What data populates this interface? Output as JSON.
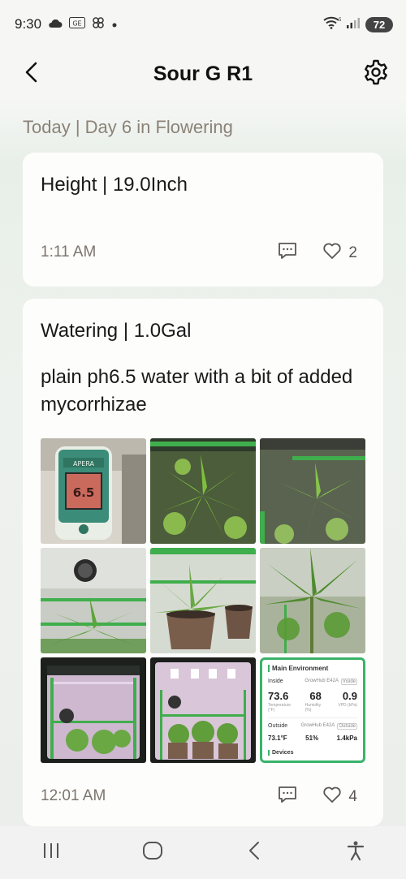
{
  "status_bar": {
    "time": "9:30",
    "battery": "72",
    "icons": [
      "cloud-icon",
      "ge-badge-icon",
      "pinwheel-icon",
      "dot-icon",
      "wifi-icon",
      "signal-icon"
    ]
  },
  "header": {
    "title": "Sour G R1",
    "back_icon": "chevron-left-icon",
    "settings_icon": "gear-icon"
  },
  "day_heading": "Today | Day 6 in Flowering",
  "entries": [
    {
      "title": "Height | 19.0Inch",
      "time": "1:11 AM",
      "likes": "2"
    },
    {
      "title": "Watering | 1.0Gal",
      "body": "plain ph6.5 water with a bit of added mycorrhizae",
      "time": "12:01 AM",
      "likes": "4",
      "photos": [
        "ph-meter-photo",
        "plant-canopy-photo-1",
        "plant-canopy-photo-2",
        "tent-plant-photo",
        "potted-plants-photo",
        "plant-closeup-photo",
        "grow-tent-photo-1",
        "grow-tent-photo-2",
        "environment-screenshot"
      ],
      "meter_reading": "6.5",
      "environment": {
        "title": "Main Environment",
        "inside_label": "Inside",
        "inside_device": "GrowHub E42A",
        "inside_tag": "Inside",
        "temperature": "73.6",
        "humidity": "68",
        "vpd": "0.9",
        "temperature_label": "Temperature (°F)",
        "humidity_label": "Humidity (%)",
        "vpd_label": "VPD (kPa)",
        "outside_label": "Outside",
        "outside_device": "GrowHub E42A",
        "outside_tag": "Outside",
        "outside_temp": "73.1°F",
        "outside_humidity": "51%",
        "outside_vpd": "1.4kPa",
        "devices_label": "Devices"
      }
    }
  ],
  "colors": {
    "accent_green": "#39b36a",
    "muted_text": "#8b8278"
  }
}
